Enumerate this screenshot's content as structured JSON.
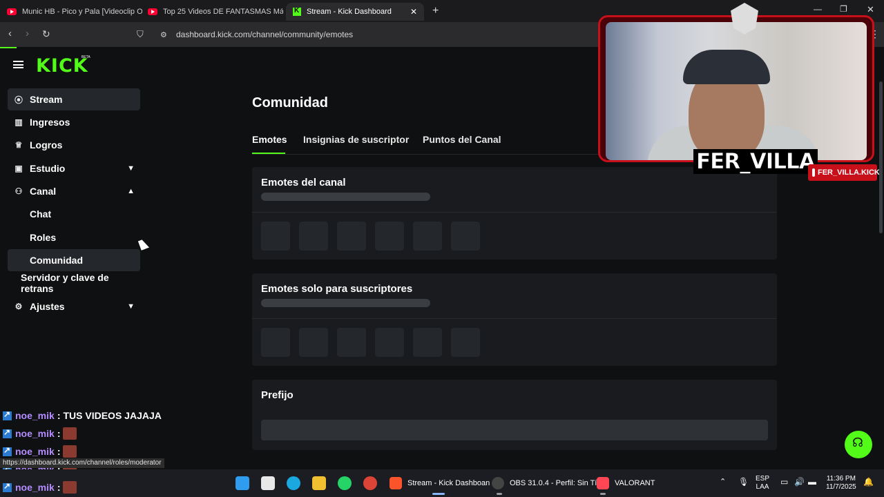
{
  "browser": {
    "tabs": [
      {
        "title": "Munic HB - Pico y Pala [Videoclip Ofi"
      },
      {
        "title": "Top 25 Videos DE FANTASMAS Más A"
      },
      {
        "title": "Stream - Kick Dashboard"
      }
    ],
    "url": "dashboard.kick.com/channel/community/emotes",
    "status_url": "https://dashboard.kick.com/channel/roles/moderator"
  },
  "brand": {
    "logo": "KICK",
    "beta": "BETA",
    "accent": "#53fc18"
  },
  "sidebar": {
    "items": [
      {
        "label": "Stream",
        "icon": "broadcast-icon"
      },
      {
        "label": "Ingresos",
        "icon": "chart-icon"
      },
      {
        "label": "Logros",
        "icon": "trophy-icon"
      },
      {
        "label": "Estudio",
        "icon": "studio-icon"
      },
      {
        "label": "Canal",
        "icon": "users-icon"
      }
    ],
    "sub_items": [
      {
        "label": "Chat"
      },
      {
        "label": "Roles"
      },
      {
        "label": "Comunidad"
      },
      {
        "label": "Servidor y clave de retrans"
      }
    ],
    "settings": {
      "label": "Ajustes",
      "icon": "gear-icon"
    }
  },
  "main": {
    "title": "Comunidad",
    "tabs": [
      {
        "label": "Emotes"
      },
      {
        "label": "Insignias de suscriptor"
      },
      {
        "label": "Puntos del Canal"
      }
    ],
    "sections": [
      {
        "title": "Emotes del canal"
      },
      {
        "title": "Emotes solo para suscriptores"
      },
      {
        "title": "Prefijo"
      }
    ]
  },
  "overlay": {
    "streamer_name": "FER_VILLA",
    "instagram": "FER_VILLA.KICK",
    "chat": [
      {
        "user": "noe_mik",
        "message": "TUS VIDEOS JAJAJA"
      },
      {
        "user": "noe_mik",
        "message": ""
      },
      {
        "user": "noe_mik",
        "message": ""
      },
      {
        "user": "noe_mik",
        "message": ""
      },
      {
        "user": "noe_mik",
        "message": ""
      }
    ]
  },
  "taskbar": {
    "apps": [
      {
        "label": "Stream - Kick Dashboan"
      },
      {
        "label": "OBS 31.0.4 - Perfil: Sin Tí"
      },
      {
        "label": "VALORANT"
      }
    ],
    "lang_top": "ESP",
    "lang_bottom": "LAA",
    "time": "11:36 PM",
    "date": "11/7/2025"
  }
}
